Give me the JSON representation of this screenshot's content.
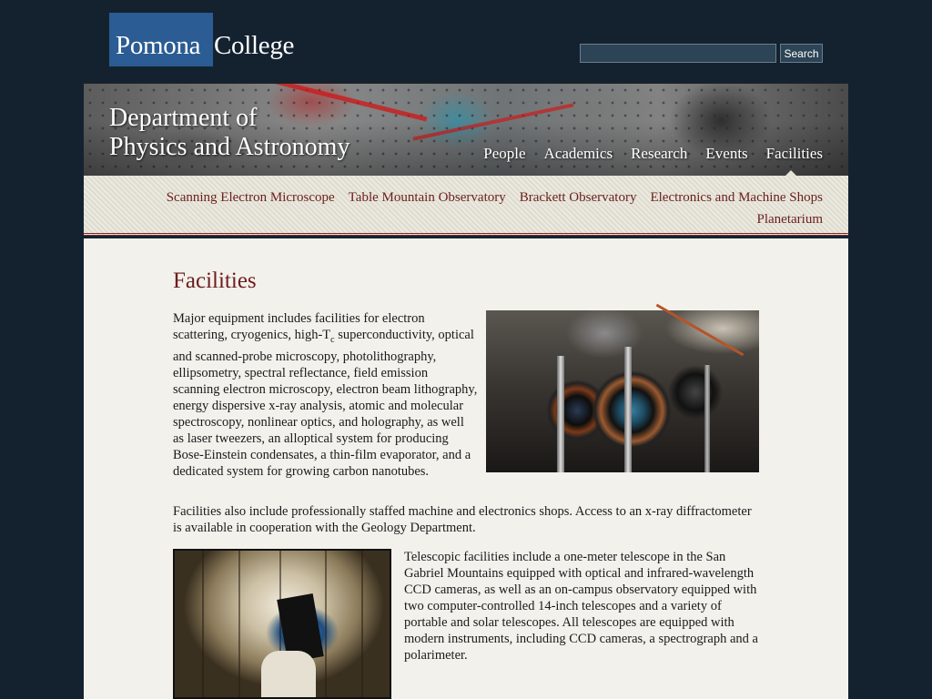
{
  "logo": {
    "part1": "Pomona",
    "part2": "College"
  },
  "search": {
    "value": "",
    "placeholder": "",
    "button_label": "Search"
  },
  "header": {
    "dept_line1": "Department of",
    "dept_line2": "Physics and Astronomy",
    "nav": [
      "People",
      "Academics",
      "Research",
      "Events",
      "Facilities"
    ],
    "active_nav": "Facilities"
  },
  "subnav": {
    "items": [
      "Scanning Electron Microscope",
      "Table Mountain Observatory",
      "Brackett Observatory",
      "Electronics and Machine Shops",
      "Planetarium"
    ]
  },
  "content": {
    "title": "Facilities",
    "paragraph1_pre": "Major equipment includes facilities for electron scattering, cryogenics, high-T",
    "paragraph1_sub": "c",
    "paragraph1_post": " superconductivity, optical and scanned-probe microscopy, photolithography, ellipsometry, spectral reflectance, field emission scanning electron microscopy, electron beam lithography, energy dispersive x-ray analysis, atomic and molecular spectroscopy, nonlinear optics, and holography, as well as laser tweezers, an alloptical system for producing Bose-Einstein condensates, a thin-film evaporator, and a dedicated system for growing carbon nanotubes.",
    "paragraph2": "Facilities also include professionally staffed machine and electronics shops. Access to an x-ray diffractometer is available in cooperation with the Geology Department.",
    "paragraph3": "Telescopic facilities include a one-meter telescope in the San Gabriel Mountains equipped with optical and infrared-wavelength CCD cameras, as well as an on-campus observatory equipped with two computer-controlled 14-inch telescopes and a variety of portable and solar telescopes. All telescopes are equipped with modern instruments, including CCD cameras, a spectrograph and a polarimeter."
  },
  "colors": {
    "page_bg": "#142230",
    "logo_blue": "#2b5c93",
    "accent_maroon": "#6b1e1e",
    "subnav_bg": "#e5e3d6",
    "content_bg": "#f3f1ec"
  }
}
